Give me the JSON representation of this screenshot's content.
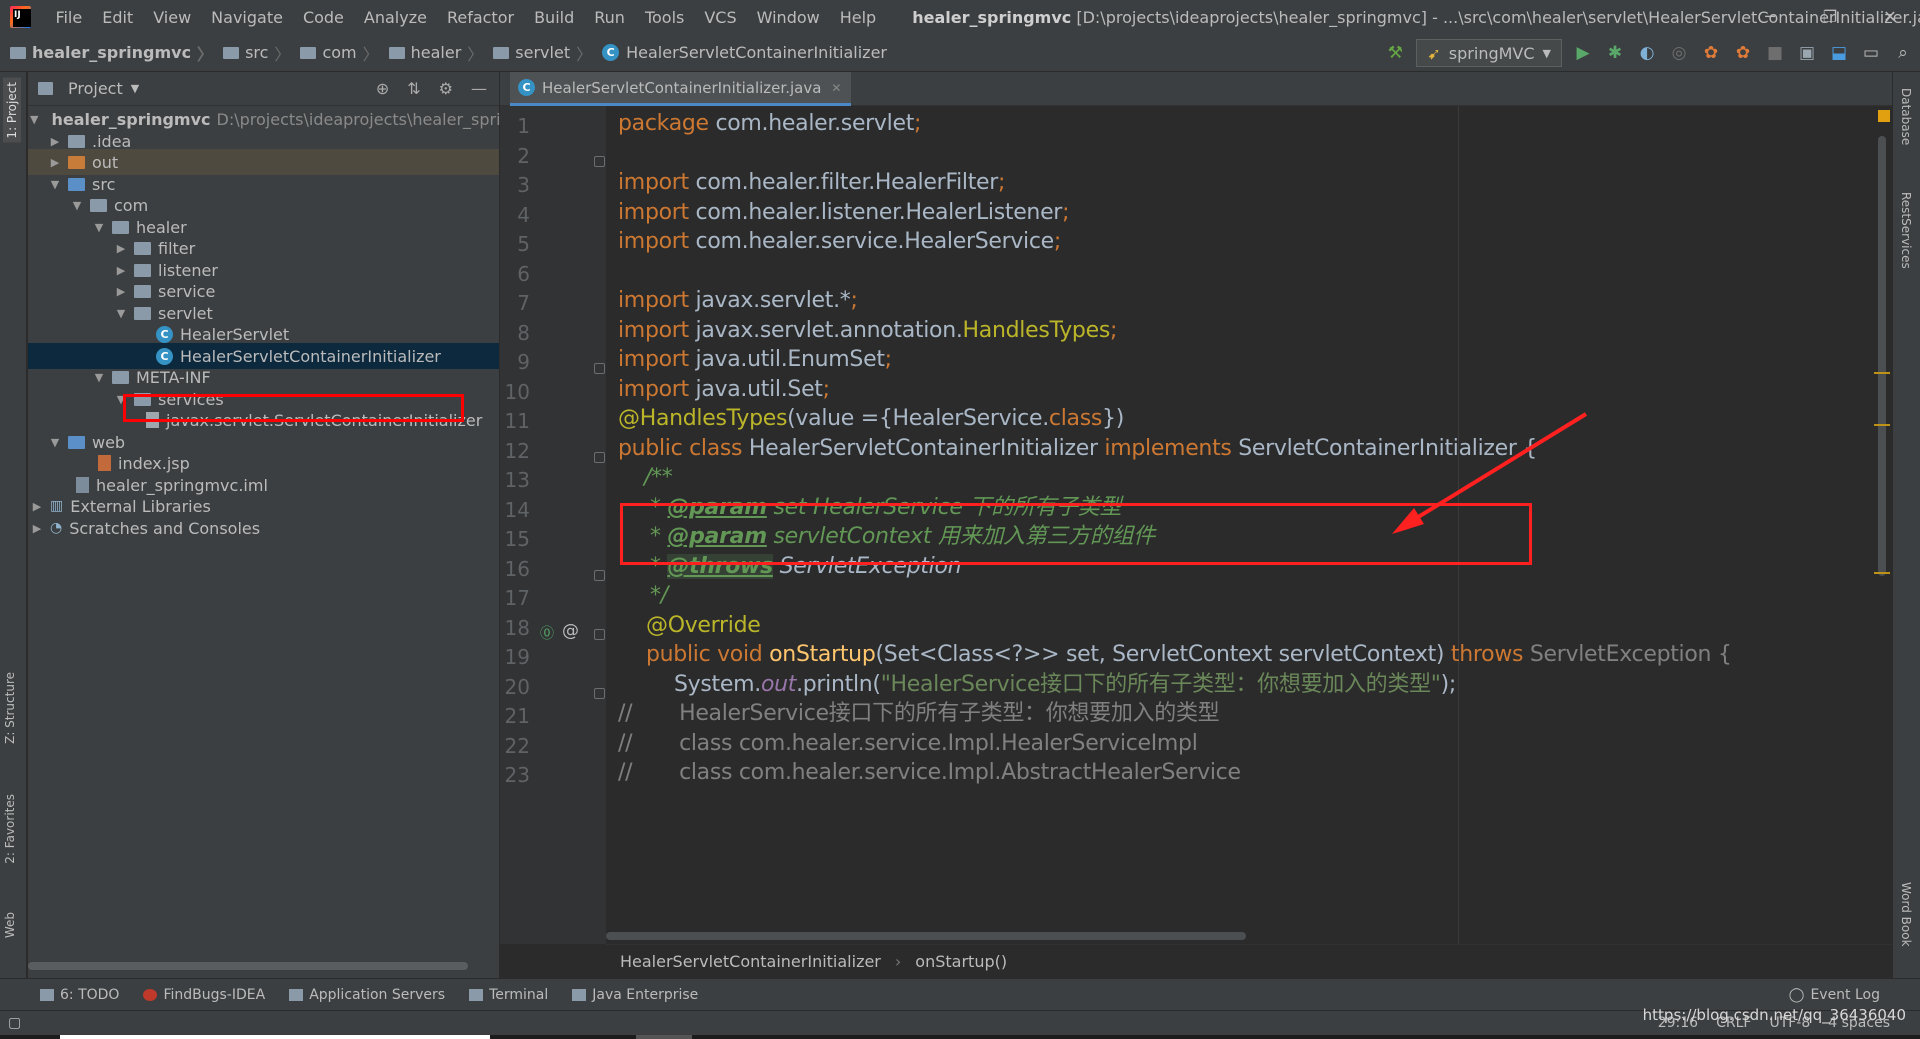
{
  "menu": {
    "items": [
      "File",
      "Edit",
      "View",
      "Navigate",
      "Code",
      "Analyze",
      "Refactor",
      "Build",
      "Run",
      "Tools",
      "VCS",
      "Window",
      "Help"
    ],
    "title_project": "healer_springmvc",
    "title_path": " [D:\\projects\\ideaprojects\\healer_springmvc] - ...\\src\\com\\healer\\servlet\\HealerServletContainerInitializer.java",
    "win_min": "─",
    "win_restore": "❐",
    "win_close": "✕"
  },
  "navbar": {
    "crumbs": [
      "healer_springmvc",
      "src",
      "com",
      "healer",
      "servlet",
      "HealerServletContainerInitializer"
    ],
    "run_config": "springMVC"
  },
  "left_strip": {
    "project": "1: Project",
    "structure": "Z: Structure",
    "favorites": "2: Favorites",
    "web": "Web"
  },
  "right_strip": {
    "database": "Database",
    "rest": "RestServices",
    "wordbook": "Word Book"
  },
  "project_panel": {
    "title": "Project",
    "tree": [
      {
        "label": "healer_springmvc",
        "hint": "D:\\projects\\ideaprojects\\healer_spring"
      },
      {
        "label": ".idea"
      },
      {
        "label": "out"
      },
      {
        "label": "src"
      },
      {
        "label": "com"
      },
      {
        "label": "healer"
      },
      {
        "label": "filter"
      },
      {
        "label": "listener"
      },
      {
        "label": "service"
      },
      {
        "label": "servlet"
      },
      {
        "label": "HealerServlet"
      },
      {
        "label": "HealerServletContainerInitializer"
      },
      {
        "label": "META-INF"
      },
      {
        "label": "services"
      },
      {
        "label": "javax.servlet.ServletContainerInitializer"
      },
      {
        "label": "web"
      },
      {
        "label": "index.jsp"
      },
      {
        "label": "healer_springmvc.iml"
      },
      {
        "label": "External Libraries"
      },
      {
        "label": "Scratches and Consoles"
      }
    ]
  },
  "editor": {
    "tab_label": "HealerServletContainerInitializer.java",
    "line_numbers": [
      "1",
      "2",
      "3",
      "4",
      "5",
      "6",
      "7",
      "8",
      "9",
      "10",
      "11",
      "12",
      "13",
      "14",
      "15",
      "16",
      "17",
      "18",
      "19",
      "20",
      "21",
      "22",
      "23"
    ],
    "code": {
      "l1a": "package",
      "l1b": " com.healer.servlet",
      "l1c": ";",
      "l3a": "import",
      "l3b": " com.healer.filter.HealerFilter",
      "l3c": ";",
      "l4a": "import",
      "l4b": " com.healer.listener.HealerListener",
      "l4c": ";",
      "l5a": "import",
      "l5b": " com.healer.service.HealerService",
      "l5c": ";",
      "l7a": "import",
      "l7b": " javax.servlet.*",
      "l7c": ";",
      "l8a": "import",
      "l8b": " javax.servlet.annotation.",
      "l8c": "HandlesTypes",
      "l8d": ";",
      "l9a": "import",
      "l9b": " java.util.EnumSet",
      "l9c": ";",
      "l10a": "import",
      "l10b": " java.util.Set",
      "l10c": ";",
      "l11a": "@HandlesTypes",
      "l11b": "(value =",
      "l11c": "{HealerService.",
      "l11d": "class",
      "l11e": "})",
      "l12a": "public class",
      "l12b": " HealerServletContainerInitializer ",
      "l12c": "implements",
      "l12d": " ServletContainerInitializer {",
      "l13": "/**",
      "l14a": "* ",
      "l14b": "@param",
      "l14c": " set HealerService 下的所有子类型",
      "l15a": "* ",
      "l15b": "@param",
      "l15c": " servletContext 用来加入第三方的组件",
      "l16a": "* ",
      "l16b": "@throws",
      "l16c": " ServletException",
      "l17": "*/",
      "l18": "@Override",
      "l19a": "public void ",
      "l19b": "onStartup",
      "l19c": "(Set<Class<?>> set, ServletContext servletContext) ",
      "l19d": "throws",
      "l19e": " ServletException {",
      "l20a": "System.",
      "l20b": "out",
      "l20c": ".println(",
      "l20d": "\"HealerService接口下的所有子类型：你想要加入的类型\"",
      "l20e": ");",
      "l21": "//       HealerService接口下的所有子类型：你想要加入的类型",
      "l22": "//       class com.healer.service.Impl.HealerServiceImpl",
      "l23": "//       class com.healer.service.Impl.AbstractHealerService"
    },
    "breadcrumb": [
      "HealerServletContainerInitializer",
      "onStartup()"
    ]
  },
  "bottom_tools": {
    "items": [
      "6: TODO",
      "FindBugs-IDEA",
      "Application Servers",
      "Terminal",
      "Java Enterprise"
    ],
    "event_log": "Event Log"
  },
  "status": {
    "position": "29:16",
    "line_sep": "CRLF",
    "encoding": "UTF-8",
    "indent": "4 spaces",
    "watermark": "https://blog.csdn.net/qq_36436040"
  },
  "colors": {
    "keyword": "#cc7832",
    "annotation": "#bbb529",
    "string": "#6a8759",
    "comment": "#629755",
    "highlight_box": "#ff2020",
    "selection": "#0d293e"
  }
}
